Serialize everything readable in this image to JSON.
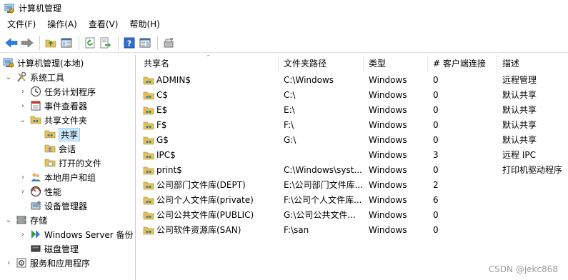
{
  "window": {
    "title": "计算机管理"
  },
  "menu": [
    "文件(F)",
    "操作(A)",
    "查看(V)",
    "帮助(H)"
  ],
  "toolbar": [
    "back-icon",
    "forward-icon",
    "up-folder-icon",
    "show-hide-tree-icon",
    "refresh-icon",
    "export-list-icon",
    "help-icon",
    "show-hide-action-pane-icon",
    "new-share-icon"
  ],
  "tree": [
    {
      "label": "计算机管理(本地)",
      "icon": "computer-management-icon",
      "arrow": ""
    },
    {
      "label": "系统工具",
      "icon": "tools-icon",
      "arrow": "⌄"
    },
    {
      "label": "任务计划程序",
      "icon": "clock-icon",
      "arrow": "›"
    },
    {
      "label": "事件查看器",
      "icon": "event-viewer-icon",
      "arrow": "›"
    },
    {
      "label": "共享文件夹",
      "icon": "shared-folder-icon",
      "arrow": "⌄"
    },
    {
      "label": "共享",
      "icon": "share-icon",
      "arrow": ""
    },
    {
      "label": "会话",
      "icon": "session-icon",
      "arrow": ""
    },
    {
      "label": "打开的文件",
      "icon": "open-files-icon",
      "arrow": ""
    },
    {
      "label": "本地用户和组",
      "icon": "users-icon",
      "arrow": "›"
    },
    {
      "label": "性能",
      "icon": "performance-icon",
      "arrow": "›"
    },
    {
      "label": "设备管理器",
      "icon": "device-manager-icon",
      "arrow": ""
    },
    {
      "label": "存储",
      "icon": "storage-icon",
      "arrow": "⌄"
    },
    {
      "label": "Windows Server 备份",
      "icon": "backup-icon",
      "arrow": "›"
    },
    {
      "label": "磁盘管理",
      "icon": "disk-management-icon",
      "arrow": ""
    },
    {
      "label": "服务和应用程序",
      "icon": "services-icon",
      "arrow": "›"
    }
  ],
  "columns": [
    "共享名",
    "文件夹路径",
    "类型",
    "# 客户端连接",
    "描述"
  ],
  "shares": [
    {
      "name": "ADMIN$",
      "path": "C:\\Windows",
      "type": "Windows",
      "clients": "0",
      "desc": "远程管理"
    },
    {
      "name": "C$",
      "path": "C:\\",
      "type": "Windows",
      "clients": "0",
      "desc": "默认共享"
    },
    {
      "name": "E$",
      "path": "E:\\",
      "type": "Windows",
      "clients": "0",
      "desc": "默认共享"
    },
    {
      "name": "F$",
      "path": "F:\\",
      "type": "Windows",
      "clients": "0",
      "desc": "默认共享"
    },
    {
      "name": "G$",
      "path": "G:\\",
      "type": "Windows",
      "clients": "0",
      "desc": "默认共享"
    },
    {
      "name": "IPC$",
      "path": "",
      "type": "Windows",
      "clients": "3",
      "desc": "远程 IPC"
    },
    {
      "name": "print$",
      "path": "C:\\Windows\\syst...",
      "type": "Windows",
      "clients": "0",
      "desc": "打印机驱动程序"
    },
    {
      "name": "公司部门文件库(DEPT)",
      "path": "E:\\公司部门文件库...",
      "type": "Windows",
      "clients": "2",
      "desc": ""
    },
    {
      "name": "公司个人文件库(private)",
      "path": "F:\\公司个人文件库...",
      "type": "Windows",
      "clients": "6",
      "desc": ""
    },
    {
      "name": "公司公共文件库(PUBLIC)",
      "path": "G:\\公司公共文件...",
      "type": "Windows",
      "clients": "0",
      "desc": ""
    },
    {
      "name": "公司软件资源库(SAN)",
      "path": "F:\\san",
      "type": "Windows",
      "clients": "0",
      "desc": ""
    }
  ],
  "watermark": "CSDN @jekc868"
}
